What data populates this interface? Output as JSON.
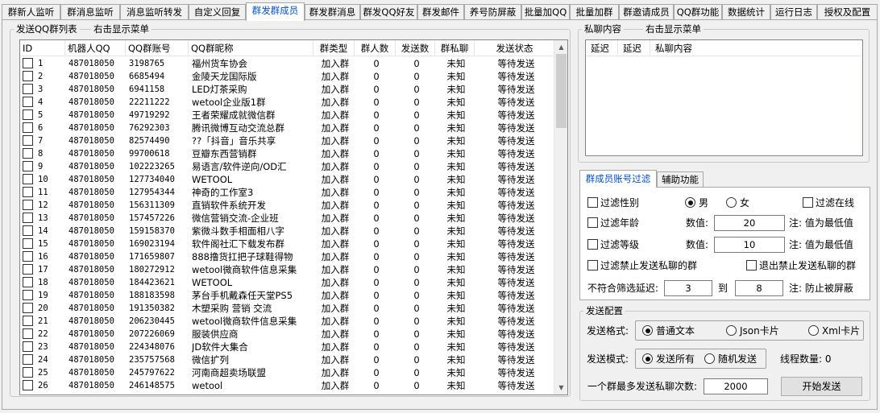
{
  "tabs": [
    {
      "label": "群新人监听",
      "active": false
    },
    {
      "label": "群消息监听",
      "active": false
    },
    {
      "label": "消息监听转发",
      "active": false
    },
    {
      "label": "自定义回复",
      "active": false
    },
    {
      "label": "群发群成员",
      "active": true
    },
    {
      "label": "群发群消息",
      "active": false
    },
    {
      "label": "群发QQ好友",
      "active": false
    },
    {
      "label": "群发邮件",
      "active": false
    },
    {
      "label": "养号防屏蔽",
      "active": false
    },
    {
      "label": "批量加QQ",
      "active": false
    },
    {
      "label": "批量加群",
      "active": false
    },
    {
      "label": "群邀请成员",
      "active": false
    },
    {
      "label": "QQ群功能",
      "active": false
    },
    {
      "label": "数据统计",
      "active": false
    },
    {
      "label": "运行日志",
      "active": false
    },
    {
      "label": "授权及配置",
      "active": false
    }
  ],
  "group_list": {
    "title": "发送QQ群列表",
    "hint": "右击显示菜单",
    "columns": [
      "ID",
      "机器人QQ",
      "QQ群账号",
      "QQ群昵称",
      "群类型",
      "群人数",
      "发送数",
      "群私聊",
      "发送状态"
    ],
    "rows": [
      [
        "1",
        "487018050",
        "3198765",
        "福州货车协会",
        "加入群",
        "0",
        "0",
        "未知",
        "等待发送"
      ],
      [
        "2",
        "487018050",
        "6685494",
        "金陵天龙国际版",
        "加入群",
        "0",
        "0",
        "未知",
        "等待发送"
      ],
      [
        "3",
        "487018050",
        "6941158",
        "LED灯茶采购",
        "加入群",
        "0",
        "0",
        "未知",
        "等待发送"
      ],
      [
        "4",
        "487018050",
        "22211222",
        "wetool企业版1群",
        "加入群",
        "0",
        "0",
        "未知",
        "等待发送"
      ],
      [
        "5",
        "487018050",
        "49719292",
        "王者荣耀成就微信群",
        "加入群",
        "0",
        "0",
        "未知",
        "等待发送"
      ],
      [
        "6",
        "487018050",
        "76292303",
        "腾讯微博互动交流总群",
        "加入群",
        "0",
        "0",
        "未知",
        "等待发送"
      ],
      [
        "7",
        "487018050",
        "82574490",
        "??「抖音」音乐共享",
        "加入群",
        "0",
        "0",
        "未知",
        "等待发送"
      ],
      [
        "8",
        "487018050",
        "99700618",
        "豆瓣东西营销群",
        "加入群",
        "0",
        "0",
        "未知",
        "等待发送"
      ],
      [
        "9",
        "487018050",
        "102223265",
        "易语言/软件逆向/OD汇",
        "加入群",
        "0",
        "0",
        "未知",
        "等待发送"
      ],
      [
        "10",
        "487018050",
        "127734040",
        "WETOOL",
        "加入群",
        "0",
        "0",
        "未知",
        "等待发送"
      ],
      [
        "11",
        "487018050",
        "127954344",
        "神奇的工作室3",
        "加入群",
        "0",
        "0",
        "未知",
        "等待发送"
      ],
      [
        "12",
        "487018050",
        "156311309",
        "直销软件系统开发",
        "加入群",
        "0",
        "0",
        "未知",
        "等待发送"
      ],
      [
        "13",
        "487018050",
        "157457226",
        "微信营销交流-企业班",
        "加入群",
        "0",
        "0",
        "未知",
        "等待发送"
      ],
      [
        "14",
        "487018050",
        "159158370",
        "紫微斗数手相面相八字",
        "加入群",
        "0",
        "0",
        "未知",
        "等待发送"
      ],
      [
        "15",
        "487018050",
        "169023194",
        "软件阁社汇下载发布群",
        "加入群",
        "0",
        "0",
        "未知",
        "等待发送"
      ],
      [
        "16",
        "487018050",
        "171659807",
        "888撸货扛把子球鞋得物",
        "加入群",
        "0",
        "0",
        "未知",
        "等待发送"
      ],
      [
        "17",
        "487018050",
        "180272912",
        "wetool微商软件信息采集",
        "加入群",
        "0",
        "0",
        "未知",
        "等待发送"
      ],
      [
        "18",
        "487018050",
        "184423621",
        "WETOOL",
        "加入群",
        "0",
        "0",
        "未知",
        "等待发送"
      ],
      [
        "19",
        "487018050",
        "188183598",
        "茅台手机戴森任天堂PS5",
        "加入群",
        "0",
        "0",
        "未知",
        "等待发送"
      ],
      [
        "20",
        "487018050",
        "191350382",
        "木塑采购 营销 交流",
        "加入群",
        "0",
        "0",
        "未知",
        "等待发送"
      ],
      [
        "21",
        "487018050",
        "206230445",
        "wetool微商软件信息采集",
        "加入群",
        "0",
        "0",
        "未知",
        "等待发送"
      ],
      [
        "22",
        "487018050",
        "207226069",
        "服装供应商",
        "加入群",
        "0",
        "0",
        "未知",
        "等待发送"
      ],
      [
        "23",
        "487018050",
        "224348076",
        "JD软件大集合",
        "加入群",
        "0",
        "0",
        "未知",
        "等待发送"
      ],
      [
        "24",
        "487018050",
        "235757568",
        "微信扩列",
        "加入群",
        "0",
        "0",
        "未知",
        "等待发送"
      ],
      [
        "25",
        "487018050",
        "245797622",
        "河南商超卖场联盟",
        "加入群",
        "0",
        "0",
        "未知",
        "等待发送"
      ],
      [
        "26",
        "487018050",
        "246148575",
        "wetool",
        "加入群",
        "0",
        "0",
        "未知",
        "等待发送"
      ]
    ]
  },
  "private_msg": {
    "title": "私聊内容",
    "hint": "右击显示菜单",
    "columns": [
      "延迟",
      "延迟",
      "私聊内容"
    ]
  },
  "filter": {
    "tabs": [
      "群成员账号过滤",
      "辅助功能"
    ],
    "gender_label": "过滤性别",
    "male": "男",
    "female": "女",
    "online_label": "过滤在线",
    "age_label": "过滤年龄",
    "level_label": "过滤等级",
    "value_label": "数值:",
    "age_value": "20",
    "level_value": "10",
    "min_note": "注: 值为最低值",
    "block_private_label": "过滤禁止发送私聊的群",
    "exit_block_label": "退出禁止发送私聊的群",
    "delay_label": "不符合筛选延迟:",
    "delay_to": "到",
    "delay_min": "3",
    "delay_max": "8",
    "delay_note": "注: 防止被屏蔽"
  },
  "send_config": {
    "title": "发送配置",
    "format_label": "发送格式:",
    "format_options": [
      "普通文本",
      "Json卡片",
      "Xml卡片"
    ],
    "mode_label": "发送模式:",
    "mode_options": [
      "发送所有",
      "随机发送"
    ],
    "thread_label": "线程数量: 0",
    "max_label": "一个群最多发送私聊次数:",
    "max_value": "2000",
    "start_button": "开始发送"
  }
}
